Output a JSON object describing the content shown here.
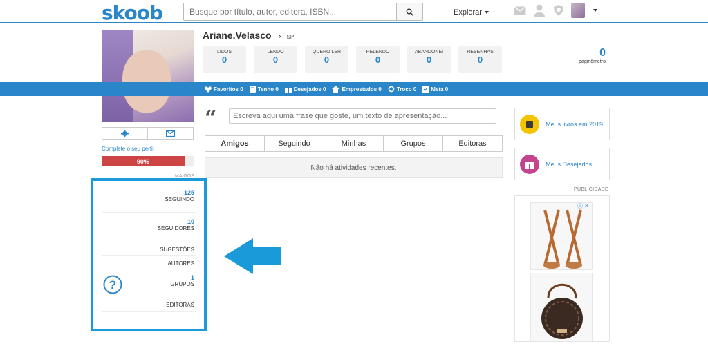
{
  "header": {
    "logo": "skoob",
    "search_placeholder": "Busque por título, autor, editora, ISBN...",
    "explorar": "Explorar"
  },
  "profile": {
    "name": "Ariane.Velasco",
    "separator": "›",
    "state": "SP",
    "complete_label": "Complete o seu perfil",
    "progress_label": "90%",
    "progress_value": 90
  },
  "stats": [
    {
      "label": "LIDOS",
      "value": "0"
    },
    {
      "label": "LENDO",
      "value": "0"
    },
    {
      "label": "QUERO LER",
      "value": "0"
    },
    {
      "label": "RELENDO",
      "value": "0"
    },
    {
      "label": "ABANDONEI",
      "value": "0"
    },
    {
      "label": "RESENHAS",
      "value": "0"
    }
  ],
  "paginometro": {
    "value": "0",
    "label": "paginômetro"
  },
  "bluebar": [
    {
      "label": "Favoritos 0"
    },
    {
      "label": "Tenho 0"
    },
    {
      "label": "Desejados 0"
    },
    {
      "label": "Emprestados 0"
    },
    {
      "label": "Troco 0"
    },
    {
      "label": "Meta 0"
    }
  ],
  "phrase_placeholder": "Escreva aqui uma frase que goste, um texto de apresentação...",
  "tabs": [
    "Amigos",
    "Seguindo",
    "Minhas",
    "Grupos",
    "Editoras"
  ],
  "no_activity": "Não há atividades recentes.",
  "side": {
    "top_label": "MAIGOS",
    "seguindo_num": "125",
    "seguindo_label": "SEGUINDO",
    "seguidores_num": "10",
    "seguidores_label": "SEGUIDORES",
    "sugestoes": "SUGESTÕES",
    "autores": "AUTORES",
    "grupos_num": "1",
    "grupos_label": "GRUPOS",
    "editoras": "EDITORAS"
  },
  "right": {
    "card1": "Meus livros em 2019",
    "card2": "Meus Desejados",
    "publicidade": "PUBLICIDADE"
  },
  "colors": {
    "brand": "#2a86c8",
    "highlight": "#1a9ad8",
    "progress": "#cc4444",
    "card1_icon": "#f5c400",
    "card2_icon": "#c4458f"
  }
}
